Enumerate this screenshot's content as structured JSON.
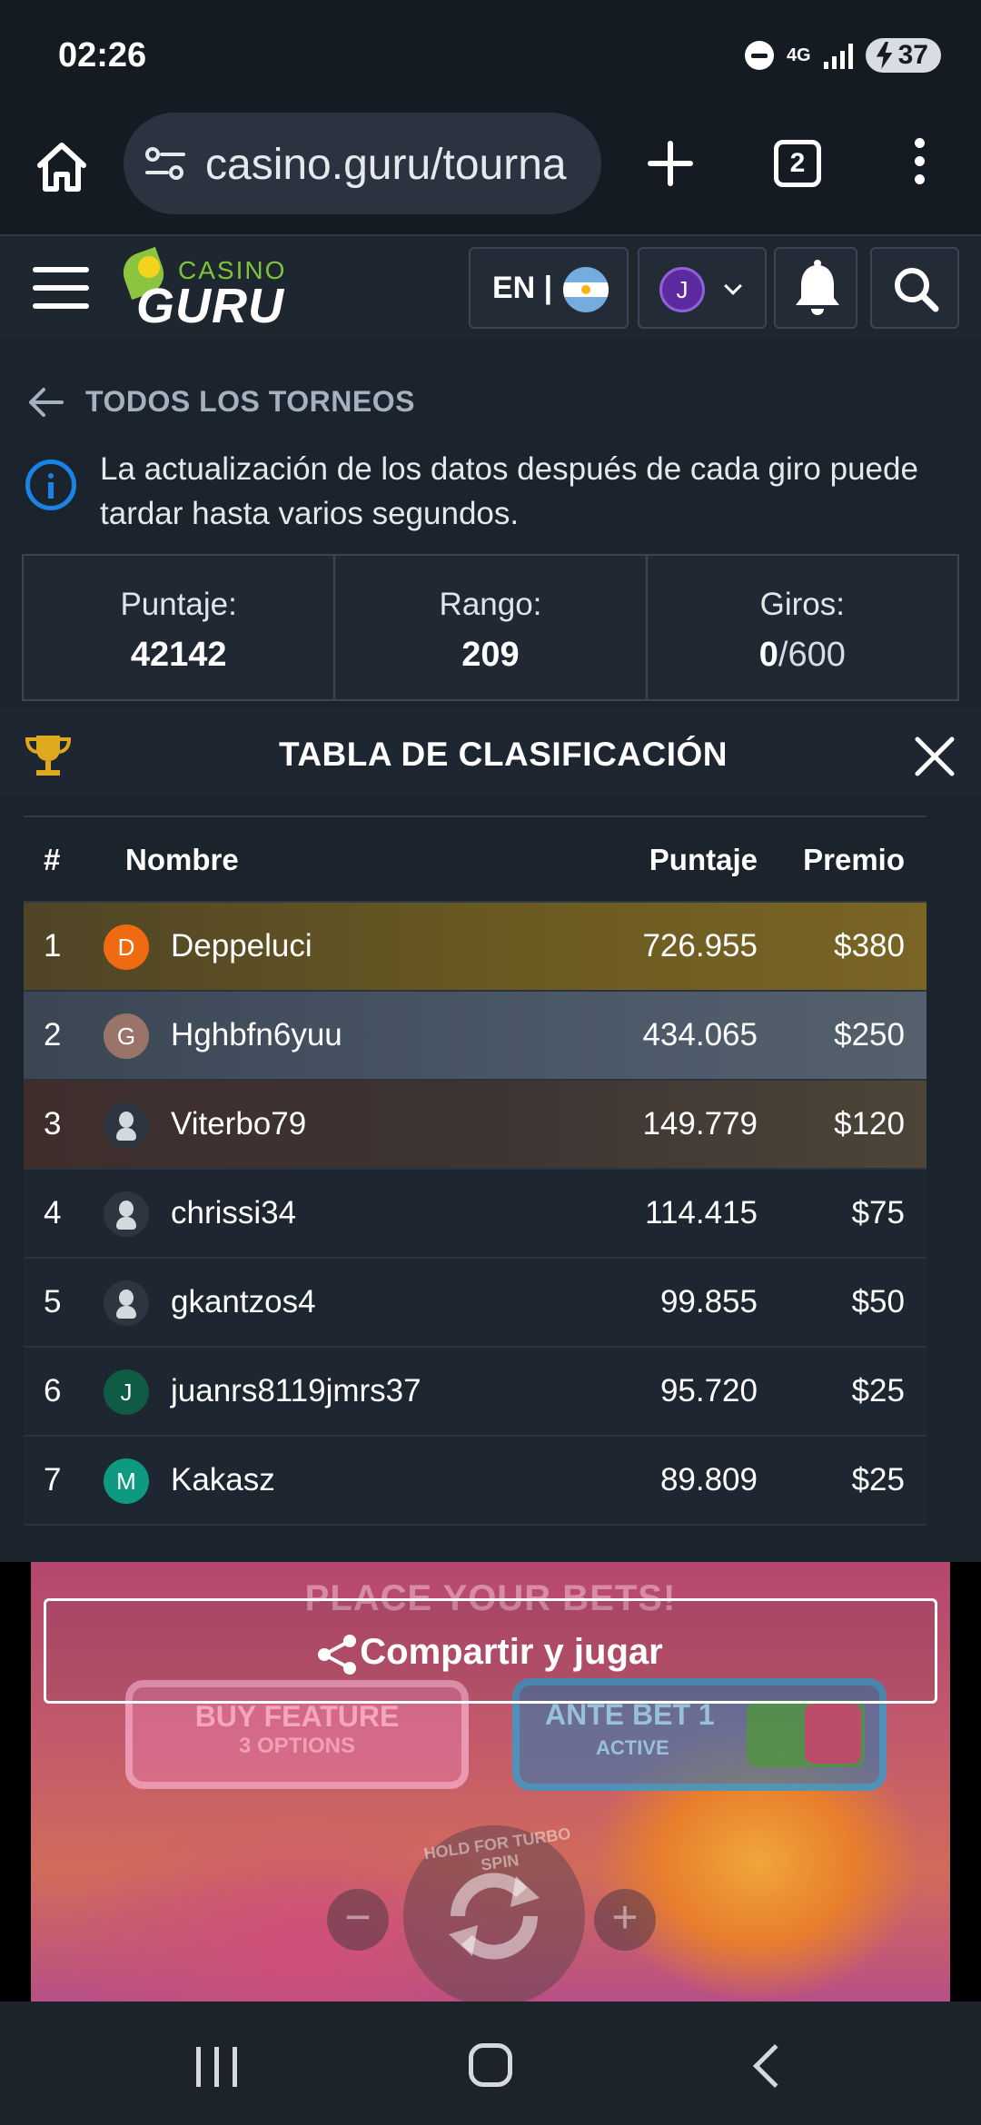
{
  "status_bar": {
    "time": "02:26",
    "network": "4G",
    "battery": "37"
  },
  "browser": {
    "url": "casino.guru/tourna",
    "tab_count": "2"
  },
  "site_header": {
    "logo_small": "CASINO",
    "logo_big": "GURU",
    "language_code": "EN |",
    "user_initial": "J"
  },
  "page": {
    "back_label": "TODOS LOS TORNEOS",
    "info_text": "La actualización de los datos después de cada giro puede tardar hasta varios segundos.",
    "stats": {
      "score_label": "Puntaje:",
      "score_value": "42142",
      "rank_label": "Rango:",
      "rank_value": "209",
      "spins_label": "Giros:",
      "spins_used": "0",
      "spins_total": "/600"
    },
    "leaderboard_title": "TABLA DE CLASIFICACIÓN"
  },
  "table": {
    "headers": {
      "num": "#",
      "name": "Nombre",
      "score": "Puntaje",
      "prize": "Premio"
    },
    "rows": [
      {
        "rank": "1",
        "initial": "D",
        "avatar_color": "#f06a12",
        "name": "Deppeluci",
        "score": "726.955",
        "prize": "$380"
      },
      {
        "rank": "2",
        "initial": "G",
        "avatar_color": "#9a7468",
        "name": "Hghbfn6yuu",
        "score": "434.065",
        "prize": "$250"
      },
      {
        "rank": "3",
        "initial": "",
        "avatar_color": "ghost",
        "name": "Viterbo79",
        "score": "149.779",
        "prize": "$120"
      },
      {
        "rank": "4",
        "initial": "",
        "avatar_color": "ghost",
        "name": "chrissi34",
        "score": "114.415",
        "prize": "$75"
      },
      {
        "rank": "5",
        "initial": "",
        "avatar_color": "ghost",
        "name": "gkantzos4",
        "score": "99.855",
        "prize": "$50"
      },
      {
        "rank": "6",
        "initial": "J",
        "avatar_color": "#0f5b44",
        "name": "juanrs8119jmrs37",
        "score": "95.720",
        "prize": "$25"
      },
      {
        "rank": "7",
        "initial": "M",
        "avatar_color": "#0e9a80",
        "name": "Kakasz",
        "score": "89.809",
        "prize": "$25"
      }
    ]
  },
  "game": {
    "place_bets": "PLACE YOUR BETS!",
    "buy_feature": "BUY FEATURE",
    "buy_feature_sub": "3 OPTIONS",
    "ante_bet": "ANTE BET 1",
    "ante_bet_sub": "ACTIVE",
    "turbo_hint": "HOLD FOR TURBO SPIN",
    "minus": "−",
    "plus": "+",
    "share_label": "Compartir y jugar"
  },
  "colors": {
    "accent_blue": "#1a84e6",
    "gold_row": "#7a6525",
    "silver_row": "#55606c",
    "bronze_row": "#4c4538"
  }
}
